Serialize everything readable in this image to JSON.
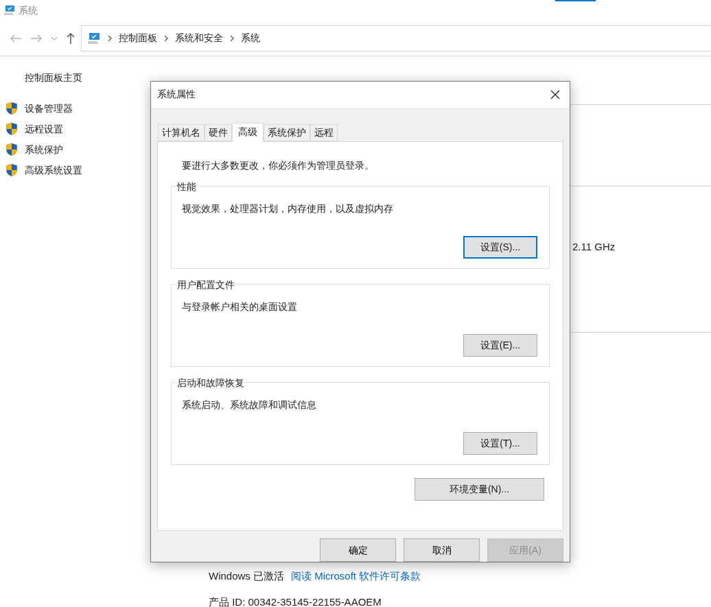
{
  "window": {
    "title": "系统"
  },
  "nav": {
    "breadcrumbs": [
      "控制面板",
      "系统和安全",
      "系统"
    ]
  },
  "sidebar": {
    "home": "控制面板主页",
    "items": [
      "设备管理器",
      "远程设置",
      "系统保护",
      "高级系统设置"
    ]
  },
  "main": {
    "processor_speed": "2.11 GHz",
    "activation": {
      "status": "Windows 已激活",
      "link": "阅读 Microsoft 软件许可条款"
    },
    "product_id": "产品 ID: 00342-35145-22155-AAOEM"
  },
  "dialog": {
    "title": "系统属性",
    "tabs": [
      {
        "label": "计算机名",
        "selected": false
      },
      {
        "label": "硬件",
        "selected": false
      },
      {
        "label": "高级",
        "selected": true
      },
      {
        "label": "系统保护",
        "selected": false
      },
      {
        "label": "远程",
        "selected": false
      }
    ],
    "notice": "要进行大多数更改，你必须作为管理员登录。",
    "groups": [
      {
        "title": "性能",
        "description": "视觉效果，处理器计划，内存使用，以及虚拟内存",
        "button": {
          "label": "设置(S)...",
          "focused": true
        }
      },
      {
        "title": "用户配置文件",
        "description": "与登录帐户相关的桌面设置",
        "button": {
          "label": "设置(E)...",
          "focused": false
        }
      },
      {
        "title": "启动和故障恢复",
        "description": "系统启动、系统故障和调试信息",
        "button": {
          "label": "设置(T)...",
          "focused": false
        }
      }
    ],
    "env_button": "环境变量(N)...",
    "buttons": [
      {
        "label": "确定",
        "disabled": false
      },
      {
        "label": "取消",
        "disabled": false
      },
      {
        "label": "应用(A)",
        "disabled": true
      }
    ]
  }
}
